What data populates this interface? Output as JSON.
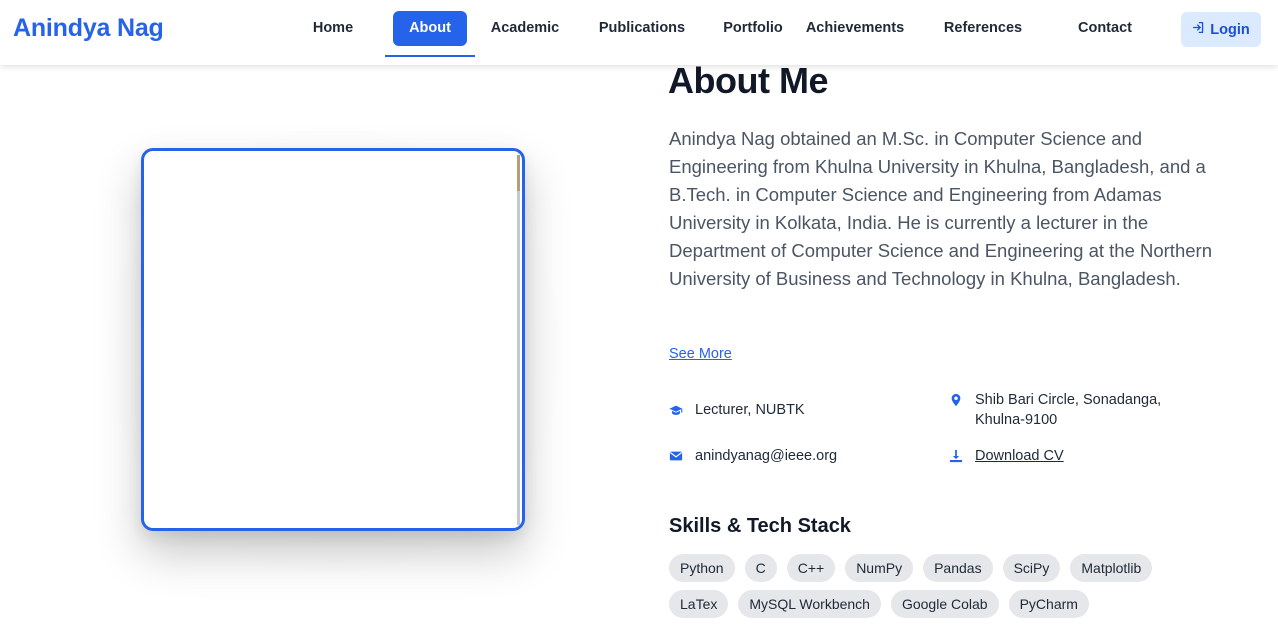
{
  "brand": "Anindya Nag",
  "nav": {
    "items": [
      {
        "label": "Home"
      },
      {
        "label": "About"
      },
      {
        "label": "Academic"
      },
      {
        "label": "Publications"
      },
      {
        "label": "Portfolio"
      },
      {
        "label": "Achievements"
      },
      {
        "label": "References"
      },
      {
        "label": "Contact"
      }
    ],
    "active": "About",
    "login_label": "Login"
  },
  "about": {
    "title": "About Me",
    "body": "Anindya Nag obtained an M.Sc. in Computer Science and Engineering from Khulna University in Khulna, Bangladesh, and a B.Tech. in Computer Science and Engineering from Adamas University in Kolkata, India. He is currently a lecturer in the Department of Computer Science and Engineering at the Northern University of Business and Technology in Khulna, Bangladesh.",
    "see_more": "See More"
  },
  "info": {
    "position": "Lecturer, NUBTK",
    "address": "Shib Bari Circle, Sonadanga, Khulna-9100",
    "email": "anindyanag@ieee.org",
    "download_cv": "Download CV"
  },
  "skills": {
    "title": "Skills & Tech Stack",
    "items": [
      "Python",
      "C",
      "C++",
      "NumPy",
      "Pandas",
      "SciPy",
      "Matplotlib",
      "LaTex",
      "MySQL Workbench",
      "Google Colab",
      "PyCharm"
    ]
  },
  "colors": {
    "accent": "#2563eb",
    "login_bg": "#dbeafe",
    "chip_bg": "#e5e7eb"
  },
  "icons": {
    "position": "graduation-cap-icon",
    "address": "map-pin-icon",
    "email": "envelope-icon",
    "download": "download-icon",
    "login": "sign-in-icon"
  }
}
